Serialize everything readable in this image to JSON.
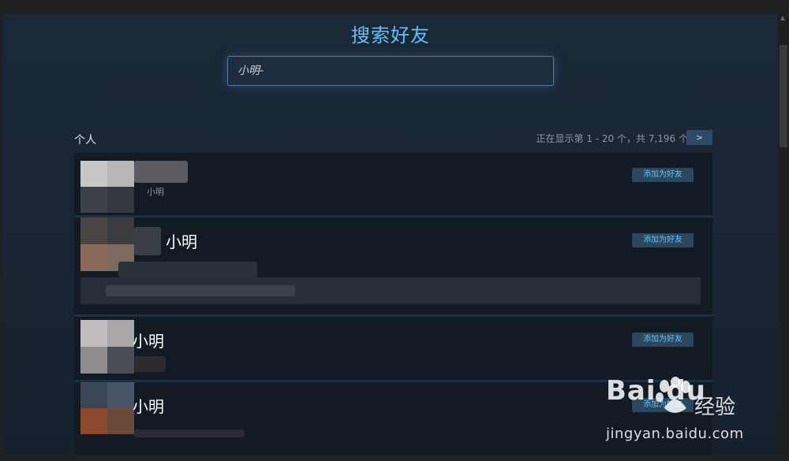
{
  "header": {
    "title": "搜索好友"
  },
  "search": {
    "value": "小明-"
  },
  "results_header": {
    "section_label": "个人",
    "pagination_text": "正在显示第 1 - 20 个，共 7,196 个",
    "next_label": ">"
  },
  "results": [
    {
      "name": "",
      "subname": "小明",
      "add_label": "添加为好友"
    },
    {
      "name": "小明",
      "add_label": "添加为好友"
    },
    {
      "name": "小明",
      "add_label": "添加为好友"
    },
    {
      "name": "小明",
      "add_label": "添加为好友"
    }
  ],
  "watermark": {
    "logo": "Bai du",
    "brand": "经验",
    "url": "jingyan.baidu.com"
  }
}
